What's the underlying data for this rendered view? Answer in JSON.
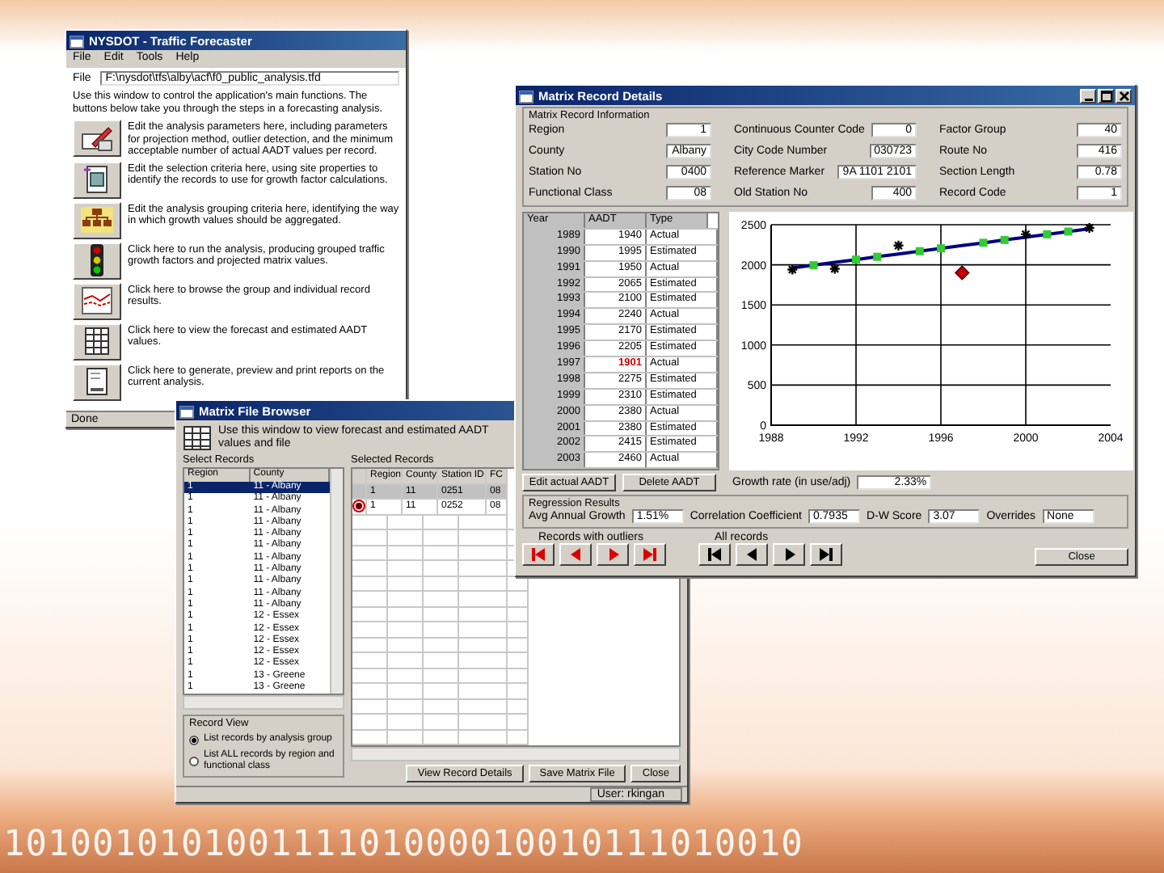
{
  "slide": {
    "footer_text": "101001010100111101000010010111010010"
  },
  "forecaster_window": {
    "title": "NYSDOT - Traffic Forecaster",
    "menu": [
      "File",
      "Edit",
      "Tools",
      "Help"
    ],
    "file_label": "File",
    "file_path": "F:\\nysdot\\tfs\\alby\\acf\\f0_public_analysis.tfd",
    "intro": "Use this window to control the application's main functions. The buttons below take you through the steps in a forecasting analysis.",
    "steps": [
      {
        "kind": "parameters",
        "text": "Edit the analysis parameters here, including parameters for projection method, outlier detection, and the minimum acceptable number of actual AADT values per record."
      },
      {
        "kind": "selection",
        "text": "Edit the selection criteria here, using site properties to identify the records to use for growth factor calculations."
      },
      {
        "kind": "grouping",
        "text": "Edit the analysis grouping criteria here, identifying the way in which growth values should be aggregated."
      },
      {
        "kind": "run",
        "text": "Click here to run the analysis, producing grouped traffic growth factors and projected matrix values."
      },
      {
        "kind": "browse",
        "text": "Click here to browse the group and individual record results."
      },
      {
        "kind": "table",
        "text": "Click here to view the forecast and estimated AADT values."
      },
      {
        "kind": "report",
        "text": "Click here to generate, preview and print reports on the current analysis."
      }
    ],
    "status": "Done"
  },
  "browser_window": {
    "title": "Matrix File Browser",
    "intro": "Use this window to view forecast and estimated AADT values and file",
    "select_label": "Select Records",
    "select_columns": [
      "Region",
      "County"
    ],
    "select_rows": [
      {
        "cells": [
          "1",
          "11 - Albany"
        ],
        "selected": true
      },
      {
        "cells": [
          "1",
          "11 - Albany"
        ],
        "selected": false
      },
      {
        "cells": [
          "1",
          "11 - Albany"
        ],
        "selected": false
      },
      {
        "cells": [
          "1",
          "11 - Albany"
        ],
        "selected": false
      },
      {
        "cells": [
          "1",
          "11 - Albany"
        ],
        "selected": false
      },
      {
        "cells": [
          "1",
          "11 - Albany"
        ],
        "selected": false
      },
      {
        "cells": [
          "1",
          "11 - Albany"
        ],
        "selected": false
      },
      {
        "cells": [
          "1",
          "11 - Albany"
        ],
        "selected": false
      },
      {
        "cells": [
          "1",
          "11 - Albany"
        ],
        "selected": false
      },
      {
        "cells": [
          "1",
          "11 - Albany"
        ],
        "selected": false
      },
      {
        "cells": [
          "1",
          "11 - Albany"
        ],
        "selected": false
      },
      {
        "cells": [
          "1",
          "12 - Essex"
        ],
        "selected": false
      },
      {
        "cells": [
          "1",
          "12 - Essex"
        ],
        "selected": false
      },
      {
        "cells": [
          "1",
          "12 - Essex"
        ],
        "selected": false
      },
      {
        "cells": [
          "1",
          "12 - Essex"
        ],
        "selected": false
      },
      {
        "cells": [
          "1",
          "12 - Essex"
        ],
        "selected": false
      },
      {
        "cells": [
          "1",
          "13 - Greene"
        ],
        "selected": false
      },
      {
        "cells": [
          "1",
          "13 - Greene"
        ],
        "selected": false
      }
    ],
    "selected_label": "Selected Records",
    "selected_columns": [
      "Region",
      "County",
      "Station ID",
      "FC"
    ],
    "selected_rows": [
      {
        "cells": [
          "1",
          "11",
          "0251",
          "08"
        ],
        "selected": true,
        "flagged": false
      },
      {
        "cells": [
          "1",
          "11",
          "0252",
          "08"
        ],
        "selected": false,
        "flagged": true
      }
    ],
    "record_view": {
      "label": "Record View",
      "options": [
        {
          "label": "List records by analysis group",
          "selected": true
        },
        {
          "label": "List ALL records by region and functional class",
          "selected": false
        }
      ]
    },
    "buttons": [
      "View Record Details",
      "Save Matrix File",
      "Close"
    ],
    "status": "User: rkingan"
  },
  "details_window": {
    "title": "Matrix Record Details",
    "info_label": "Matrix Record Information",
    "field_columns": [
      [
        {
          "label": "Region",
          "value": "1"
        },
        {
          "label": "County",
          "value": "Albany"
        },
        {
          "label": "Station No",
          "value": "0400"
        },
        {
          "label": "Functional Class",
          "value": "08"
        }
      ],
      [
        {
          "label": "Continuous Counter Code",
          "value": "0"
        },
        {
          "label": "City Code Number",
          "value": "030723"
        },
        {
          "label": "Reference Marker",
          "value": "9A 1101 2101"
        },
        {
          "label": "Old Station No",
          "value": "400"
        }
      ],
      [
        {
          "label": "Factor Group",
          "value": "40"
        },
        {
          "label": "Route No",
          "value": "416"
        },
        {
          "label": "Section Length",
          "value": "0.78"
        },
        {
          "label": "Record Code",
          "value": "1"
        }
      ]
    ],
    "table_columns": [
      "Year",
      "AADT",
      "Type"
    ],
    "table_rows": [
      {
        "cells": [
          "1989",
          "1940",
          "Actual"
        ],
        "outlier": false
      },
      {
        "cells": [
          "1990",
          "1995",
          "Estimated"
        ],
        "outlier": false
      },
      {
        "cells": [
          "1991",
          "1950",
          "Actual"
        ],
        "outlier": false
      },
      {
        "cells": [
          "1992",
          "2065",
          "Estimated"
        ],
        "outlier": false
      },
      {
        "cells": [
          "1993",
          "2100",
          "Estimated"
        ],
        "outlier": false
      },
      {
        "cells": [
          "1994",
          "2240",
          "Actual"
        ],
        "outlier": false
      },
      {
        "cells": [
          "1995",
          "2170",
          "Estimated"
        ],
        "outlier": false
      },
      {
        "cells": [
          "1996",
          "2205",
          "Estimated"
        ],
        "outlier": false
      },
      {
        "cells": [
          "1997",
          "1901",
          "Actual"
        ],
        "outlier": true
      },
      {
        "cells": [
          "1998",
          "2275",
          "Estimated"
        ],
        "outlier": false
      },
      {
        "cells": [
          "1999",
          "2310",
          "Estimated"
        ],
        "outlier": false
      },
      {
        "cells": [
          "2000",
          "2380",
          "Actual"
        ],
        "outlier": false
      },
      {
        "cells": [
          "2001",
          "2380",
          "Estimated"
        ],
        "outlier": false
      },
      {
        "cells": [
          "2002",
          "2415",
          "Estimated"
        ],
        "outlier": false
      },
      {
        "cells": [
          "2003",
          "2460",
          "Actual"
        ],
        "outlier": false
      }
    ],
    "table_buttons": [
      "Edit actual AADT",
      "Delete AADT"
    ],
    "growth_label": "Growth rate (in use/adj)",
    "growth_value": "2.33%",
    "regression": {
      "label": "Regression Results",
      "items": [
        {
          "label": "Avg Annual Growth",
          "value": "1.51%"
        },
        {
          "label": "Correlation Coefficient",
          "value": "0.7935"
        },
        {
          "label": "D-W Score",
          "value": "3.07"
        },
        {
          "label": "Overrides",
          "value": "None"
        }
      ]
    },
    "nav_groups": [
      {
        "kind": "outliers",
        "label": "Records with outliers"
      },
      {
        "kind": "all",
        "label": "All records"
      }
    ],
    "close": "Close",
    "chart_data": {
      "type": "scatter",
      "x": [
        1989,
        1990,
        1991,
        1992,
        1993,
        1994,
        1995,
        1996,
        1997,
        1998,
        1999,
        2000,
        2001,
        2002,
        2003
      ],
      "xlim": [
        1988,
        2004
      ],
      "ylim": [
        0,
        2500
      ],
      "xticks": [
        1988,
        1992,
        1996,
        2000,
        2004
      ],
      "grid": true,
      "yticks": [
        0,
        500,
        1000,
        1500,
        2000,
        2500
      ],
      "series": [
        {
          "type": "line",
          "color": "#000080",
          "values": [
            1960,
            1995,
            2030,
            2065,
            2100,
            2135,
            2170,
            2205,
            2240,
            2275,
            2310,
            2345,
            2380,
            2415,
            2450
          ]
        },
        {
          "marker": "square",
          "color": "#33cc33",
          "values": [
            null,
            1995,
            null,
            2065,
            2100,
            null,
            2170,
            2205,
            null,
            2275,
            2310,
            null,
            2380,
            2415,
            null
          ]
        },
        {
          "marker": "cross",
          "color": "#000000",
          "values": [
            1940,
            null,
            1950,
            null,
            null,
            2240,
            null,
            null,
            null,
            null,
            null,
            2380,
            null,
            null,
            2460
          ]
        },
        {
          "marker": "diamond",
          "color": "#cc0000",
          "values": [
            null,
            null,
            null,
            null,
            null,
            null,
            null,
            null,
            1901,
            null,
            null,
            null,
            null,
            null,
            null
          ]
        }
      ]
    }
  }
}
